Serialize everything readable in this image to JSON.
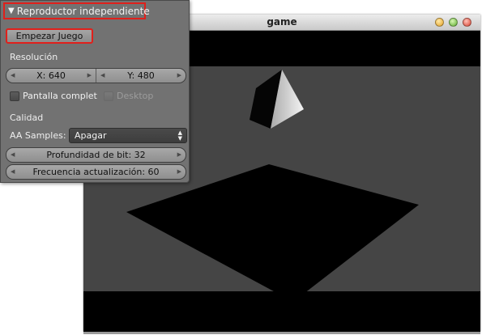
{
  "game_window": {
    "title": "game",
    "buttons": [
      "minimize",
      "maximize",
      "close"
    ]
  },
  "panel": {
    "title": "Reproductor independiente",
    "start_button": "Empezar Juego",
    "resolution_label": "Resolución",
    "res_x": "X: 640",
    "res_y": "Y: 480",
    "fullscreen_label": "Pantalla complet",
    "desktop_label": "Desktop",
    "quality_label": "Calidad",
    "aa_label": "AA Samples:",
    "aa_value": "Apagar",
    "bit_depth": "Profundidad de bit: 32",
    "refresh_rate": "Frecuencia actualización: 60"
  },
  "colors": {
    "highlight": "#e0201b",
    "panel_bg": "#727272",
    "viewport_bg": "#454545"
  }
}
